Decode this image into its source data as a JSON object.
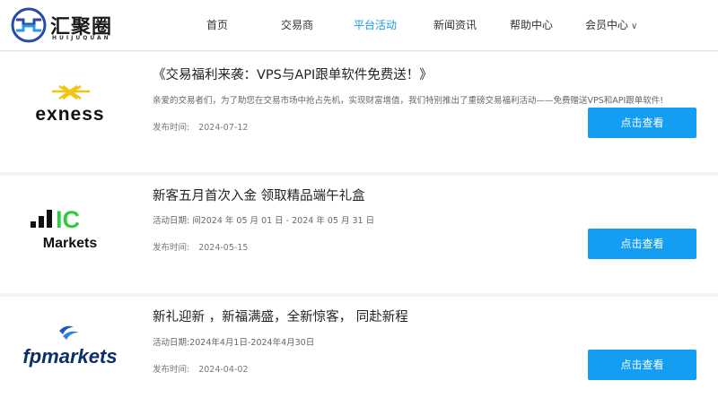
{
  "brand": {
    "name": "汇聚圈",
    "sub": "HUIJUQUAN",
    "accent": "#1b9be0",
    "button_color": "#139ef3"
  },
  "nav": [
    {
      "label": "首页",
      "active": false
    },
    {
      "label": "交易商",
      "active": false
    },
    {
      "label": "平台活动",
      "active": true
    },
    {
      "label": "新闻资讯",
      "active": false
    },
    {
      "label": "帮助中心",
      "active": false
    },
    {
      "label": "会员中心",
      "active": false,
      "icon": "chevron-down-icon"
    }
  ],
  "cards": [
    {
      "logo": "exness",
      "title": "《交易福利来袭：VPS与API跟单软件免费送！》",
      "desc": "亲爱的交易者们，为了助您在交易市场中抢占先机，实现财富增值，我们特别推出了重磅交易福利活动——免费赠送VPS和API跟单软件!",
      "date_label": "发布时间:",
      "date": "2024-07-12",
      "button": "点击查看"
    },
    {
      "logo_top": "IC",
      "logo_bottom": "Markets",
      "title": "新客五月首次入金 领取精品端午礼盒",
      "desc": "活动日期: 间2024 年 05 月 01 日 - 2024 年 05 月 31 日",
      "date_label": "发布时间:",
      "date": "2024-05-15",
      "button": "点击查看"
    },
    {
      "logo": "fpmarkets",
      "title": "新礼迎新 ，新福满盛，全新惊客， 同赴新程",
      "desc": "活动日期:2024年4月1日-2024年4月30日",
      "date_label": "发布时间:",
      "date": "2024-04-02",
      "button": "点击查看"
    }
  ]
}
